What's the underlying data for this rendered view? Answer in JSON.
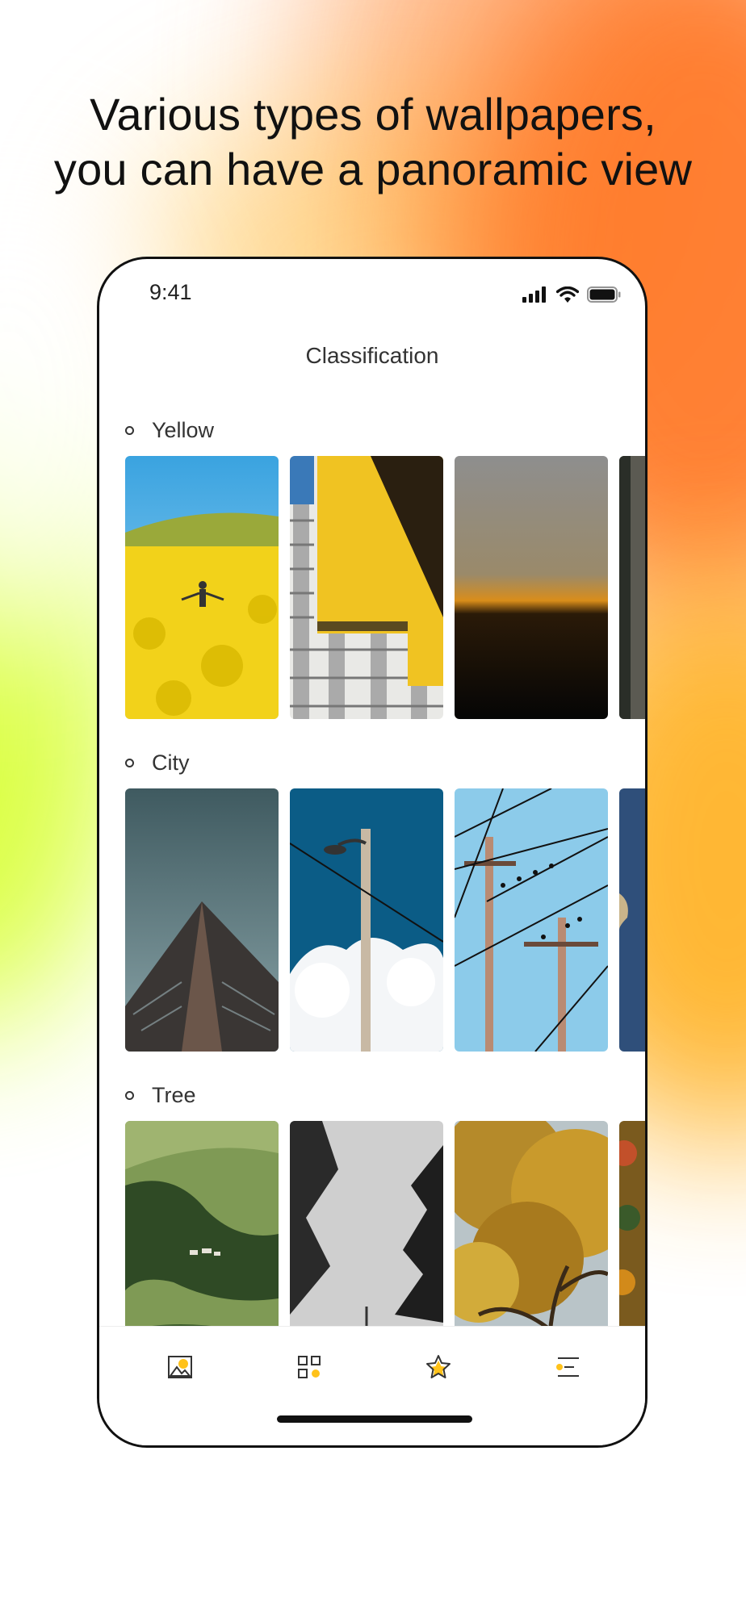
{
  "headline": {
    "line1": "Various types of wallpapers,",
    "line2": "you can have a panoramic view"
  },
  "status_bar": {
    "time": "9:41",
    "icons": [
      "signal-icon",
      "wifi-icon",
      "battery-icon"
    ]
  },
  "nav": {
    "title": "Classification"
  },
  "sections": [
    {
      "title": "Yellow",
      "images": [
        "yellow-flower-field",
        "yellow-building",
        "sunset-horizon",
        "stone-wall"
      ]
    },
    {
      "title": "City",
      "images": [
        "skyscraper",
        "street-lamp",
        "power-lines-birds",
        "coastline-aerial"
      ]
    },
    {
      "title": "Tree",
      "images": [
        "mountain-valley",
        "foggy-pines",
        "autumn-tree",
        "autumn-forest"
      ]
    }
  ],
  "tabbar": {
    "tabs": [
      {
        "name": "wallpapers",
        "icon": "image-icon"
      },
      {
        "name": "classification",
        "icon": "grid-icon"
      },
      {
        "name": "favorites",
        "icon": "star-icon"
      },
      {
        "name": "menu",
        "icon": "menu-list-icon"
      }
    ]
  },
  "colors": {
    "accent": "#ffc21a",
    "text": "#333333",
    "frame": "#111111"
  }
}
